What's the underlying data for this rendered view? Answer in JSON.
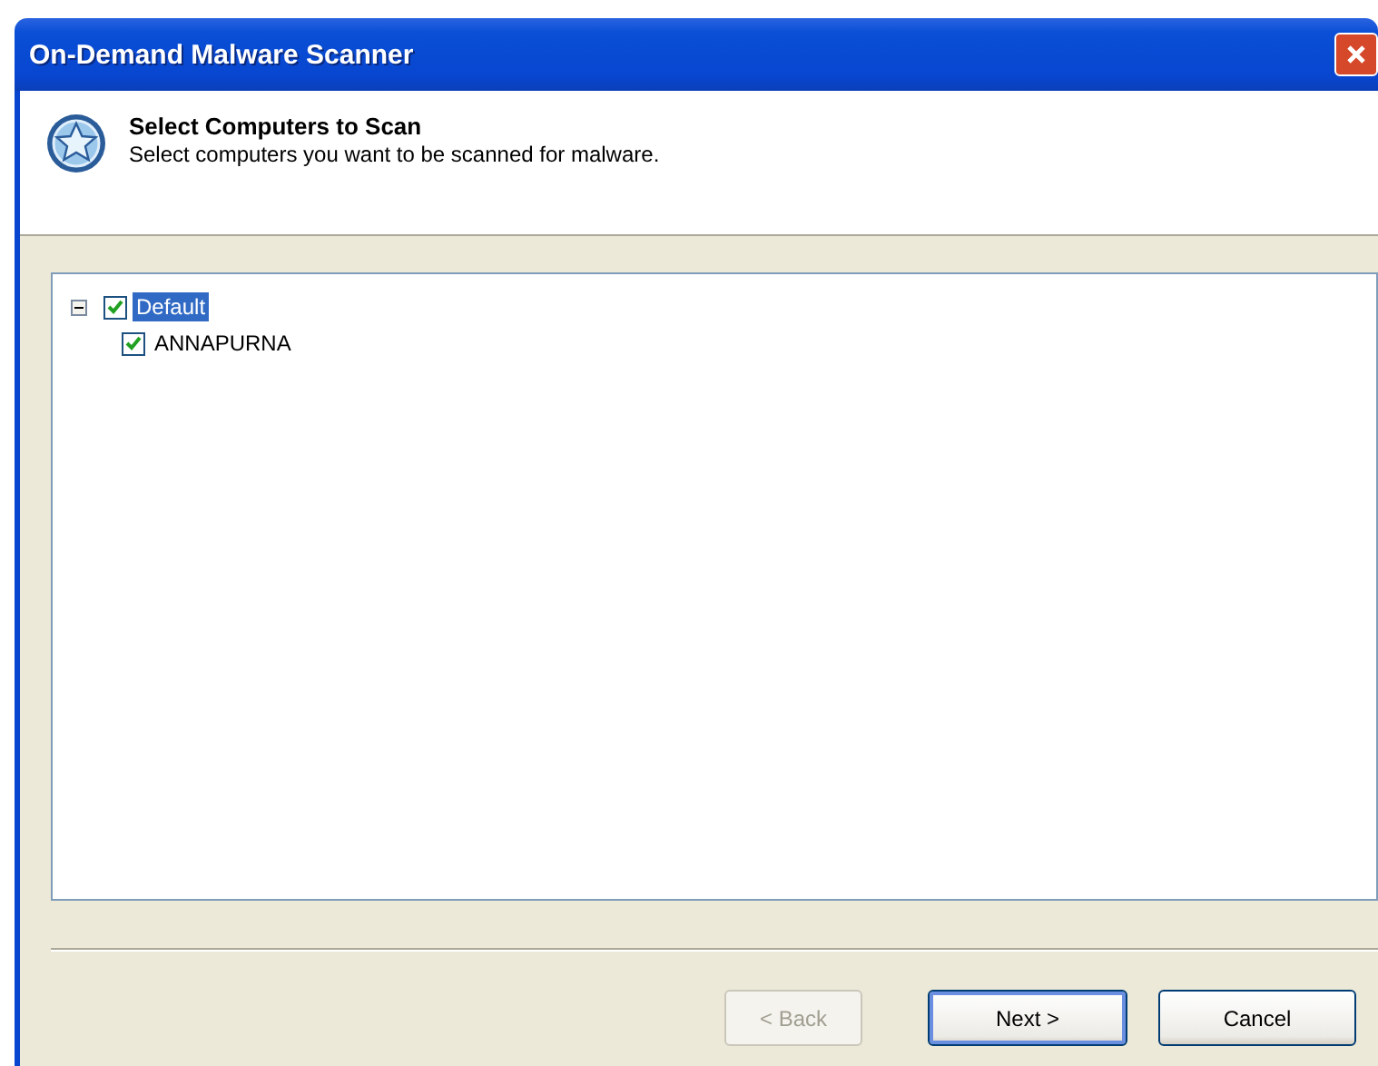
{
  "window": {
    "title": "On-Demand Malware Scanner"
  },
  "header": {
    "title": "Select Computers to Scan",
    "subtitle": "Select computers you want to be scanned for malware."
  },
  "tree": [
    {
      "label": "Default",
      "checked": true,
      "selected": true,
      "expanded": true,
      "children": [
        {
          "label": "ANNAPURNA",
          "checked": true,
          "selected": false
        }
      ]
    }
  ],
  "buttons": [
    {
      "label": "< Back",
      "disabled": true,
      "default": false
    },
    {
      "label": "Next >",
      "disabled": false,
      "default": true
    },
    {
      "label": "Cancel",
      "disabled": false,
      "default": false
    }
  ]
}
